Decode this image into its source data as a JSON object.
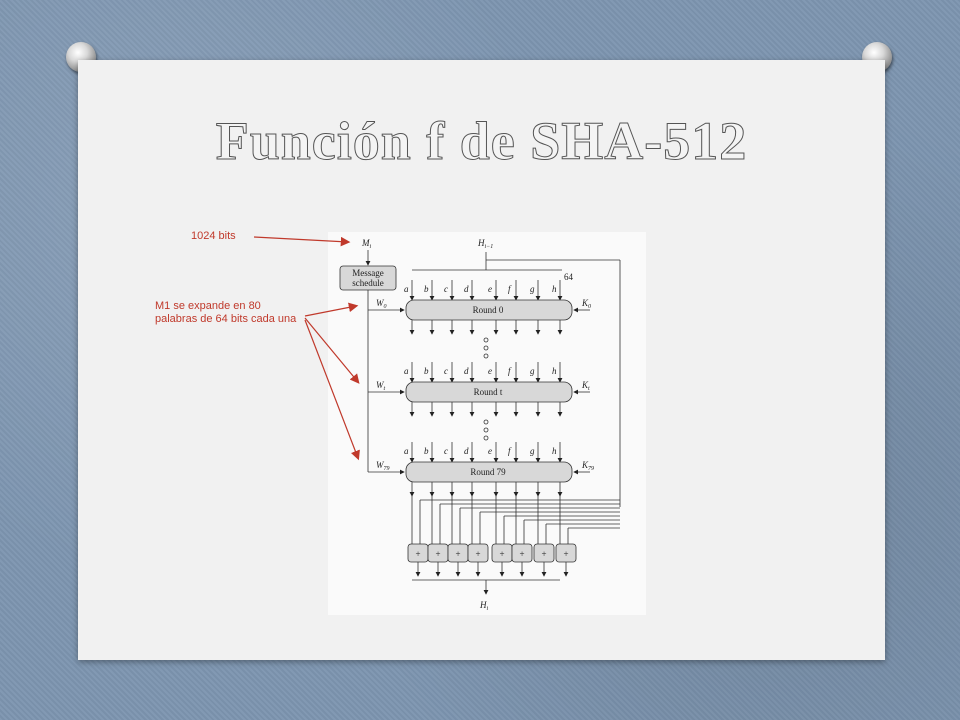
{
  "slide": {
    "title": "Función f de SHA-512",
    "annotations": {
      "bits": "1024 bits",
      "expand": "M1 se expande en 80 palabras de 64 bits cada una"
    },
    "colors": {
      "annotation": "#c0392b",
      "background": "#7d95b0"
    }
  },
  "diagram": {
    "input_message": "M",
    "input_message_sub": "i",
    "input_hash": "H",
    "input_hash_sub": "i−1",
    "output_hash": "H",
    "output_hash_sub": "i",
    "message_schedule": [
      "Message",
      "schedule"
    ],
    "width_label": "64",
    "register_labels": [
      "a",
      "b",
      "c",
      "d",
      "e",
      "f",
      "g",
      "h"
    ],
    "rounds": [
      {
        "label": "Round 0",
        "w": "W",
        "w_sub": "0",
        "k": "K",
        "k_sub": "0"
      },
      {
        "label": "Round t",
        "w": "W",
        "w_sub": "t",
        "k": "K",
        "k_sub": "t"
      },
      {
        "label": "Round 79",
        "w": "W",
        "w_sub": "79",
        "k": "K",
        "k_sub": "79"
      }
    ],
    "adder_symbol": "+"
  }
}
